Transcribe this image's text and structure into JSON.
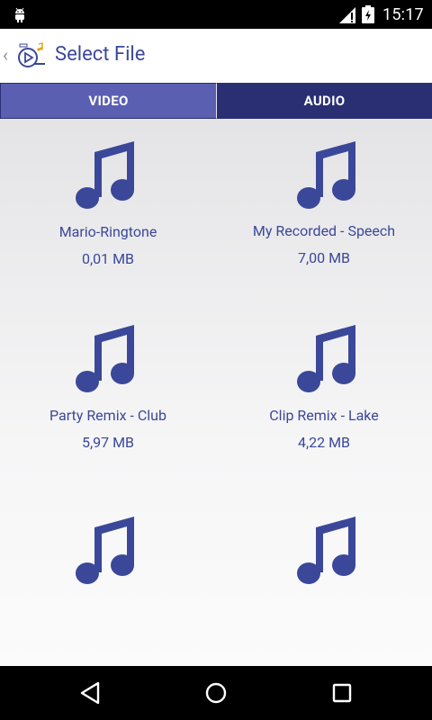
{
  "status_bar": {
    "time": "15:17",
    "left_icon": "android-debug-icon",
    "signal_icon": "signal-icon",
    "battery_icon": "battery-charging-icon"
  },
  "app_bar": {
    "title": "Select File",
    "back_icon": "chevron-left-icon",
    "logo_icon": "app-logo-icon"
  },
  "tabs": [
    {
      "label": "VIDEO",
      "selected": false
    },
    {
      "label": "AUDIO",
      "selected": true
    }
  ],
  "files": [
    {
      "name": "Mario-Ringtone",
      "size": "0,01 MB",
      "icon": "music-note-icon"
    },
    {
      "name": "My Recorded - Speech",
      "size": "7,00 MB",
      "icon": "music-note-icon"
    },
    {
      "name": "Party Remix - Club",
      "size": "5,97 MB",
      "icon": "music-note-icon"
    },
    {
      "name": "Clip Remix - Lake",
      "size": "4,22 MB",
      "icon": "music-note-icon"
    },
    {
      "name": "",
      "size": "",
      "icon": "music-note-icon"
    },
    {
      "name": "",
      "size": "",
      "icon": "music-note-icon"
    }
  ],
  "nav_bar": {
    "back_icon": "back-triangle-icon",
    "home_icon": "home-circle-icon",
    "recents_icon": "recents-square-icon"
  },
  "colors": {
    "accent": "#3b4899",
    "tab_inactive": "#5a5fb1",
    "tab_active": "#2a2f73"
  }
}
